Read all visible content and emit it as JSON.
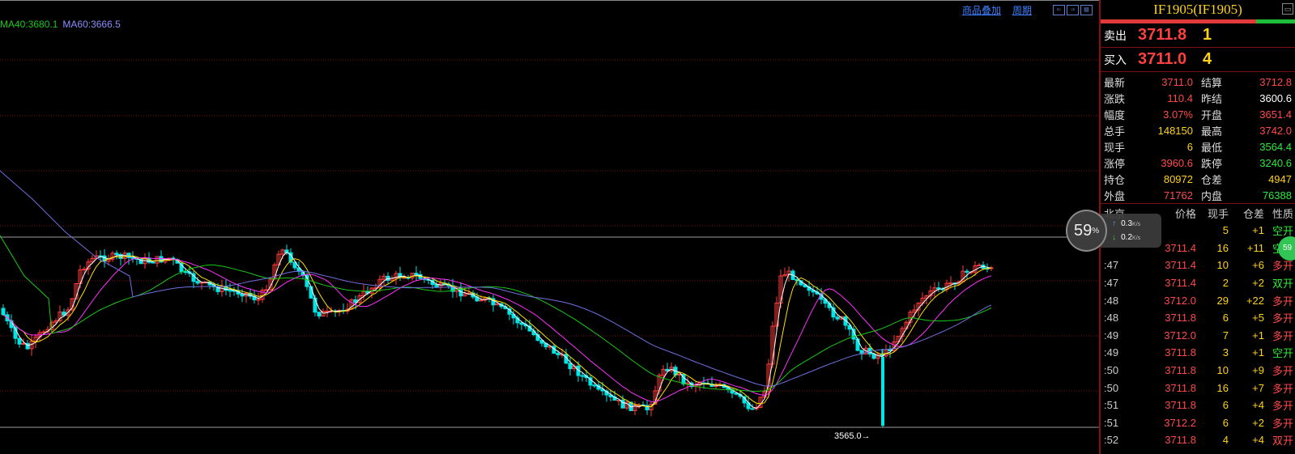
{
  "legend": {
    "ma40": "MA40:3680.1",
    "ma60": "MA60:3666.5"
  },
  "top_links": {
    "overlay": "商品叠加",
    "period": "周期"
  },
  "chart_annotation": {
    "low_label": "3565.0→"
  },
  "quote": {
    "title": "IF1905(IF1905)",
    "sell": {
      "label": "卖出",
      "price": "3711.8",
      "qty": "1"
    },
    "buy": {
      "label": "买入",
      "price": "3711.0",
      "qty": "4"
    },
    "stats": [
      {
        "l1": "最新",
        "v1": "3711.0",
        "c1": "red",
        "l2": "结算",
        "v2": "3712.8",
        "c2": "red"
      },
      {
        "l1": "涨跌",
        "v1": "110.4",
        "c1": "red",
        "l2": "昨结",
        "v2": "3600.6",
        "c2": "white"
      },
      {
        "l1": "幅度",
        "v1": "3.07%",
        "c1": "red",
        "l2": "开盘",
        "v2": "3651.4",
        "c2": "red"
      },
      {
        "l1": "总手",
        "v1": "148150",
        "c1": "yellow",
        "l2": "最高",
        "v2": "3742.0",
        "c2": "red"
      },
      {
        "l1": "现手",
        "v1": "6",
        "c1": "yellow",
        "l2": "最低",
        "v2": "3564.4",
        "c2": "green"
      },
      {
        "l1": "涨停",
        "v1": "3960.6",
        "c1": "red",
        "l2": "跌停",
        "v2": "3240.6",
        "c2": "green"
      },
      {
        "l1": "持仓",
        "v1": "80972",
        "c1": "yellow",
        "l2": "仓差",
        "v2": "4947",
        "c2": "yellow"
      },
      {
        "l1": "外盘",
        "v1": "71762",
        "c1": "red",
        "l2": "内盘",
        "v2": "76388",
        "c2": "green"
      }
    ],
    "trade_header": [
      "北京",
      "价格",
      "现手",
      "仓差",
      "性质"
    ],
    "trades": [
      {
        "time": "",
        "price": "",
        "vol": "5",
        "oi": "+1",
        "type": "空开",
        "tc": "green"
      },
      {
        "time": "",
        "price": "3711.4",
        "vol": "16",
        "oi": "+11",
        "type": "空开",
        "tc": "green"
      },
      {
        "time": ":47",
        "price": "3711.4",
        "vol": "10",
        "oi": "+6",
        "type": "多开",
        "tc": "red"
      },
      {
        "time": ":47",
        "price": "3711.4",
        "vol": "2",
        "oi": "+2",
        "type": "双开",
        "tc": "green"
      },
      {
        "time": ":48",
        "price": "3712.0",
        "vol": "29",
        "oi": "+22",
        "type": "多开",
        "tc": "red"
      },
      {
        "time": ":48",
        "price": "3711.8",
        "vol": "6",
        "oi": "+5",
        "type": "多开",
        "tc": "red"
      },
      {
        "time": ":49",
        "price": "3712.0",
        "vol": "7",
        "oi": "+1",
        "type": "多开",
        "tc": "red"
      },
      {
        "time": ":49",
        "price": "3711.8",
        "vol": "3",
        "oi": "+1",
        "type": "空开",
        "tc": "green"
      },
      {
        "time": ":50",
        "price": "3711.8",
        "vol": "10",
        "oi": "+9",
        "type": "多开",
        "tc": "red"
      },
      {
        "time": ":50",
        "price": "3711.8",
        "vol": "16",
        "oi": "+7",
        "type": "多开",
        "tc": "red"
      },
      {
        "time": ":51",
        "price": "3711.8",
        "vol": "6",
        "oi": "+4",
        "type": "多开",
        "tc": "red"
      },
      {
        "time": ":51",
        "price": "3712.2",
        "vol": "6",
        "oi": "+2",
        "type": "多开",
        "tc": "red"
      },
      {
        "time": ":52",
        "price": "3711.8",
        "vol": "4",
        "oi": "+4",
        "type": "双开",
        "tc": "red"
      }
    ]
  },
  "speed_widget": {
    "percent": "59",
    "pct_sign": "%",
    "up": "0.3",
    "down": "0.2",
    "unit": "K/s",
    "badge": "59"
  },
  "colors": {
    "up": "#ff3c3c",
    "down": "#00e5e5",
    "ma_white": "#ffffff",
    "ma_yellow": "#ffe000",
    "ma_magenta": "#ff30ff",
    "ma40": "#19c819",
    "ma60": "#6f6fe0",
    "grid": "#7a1010"
  }
}
